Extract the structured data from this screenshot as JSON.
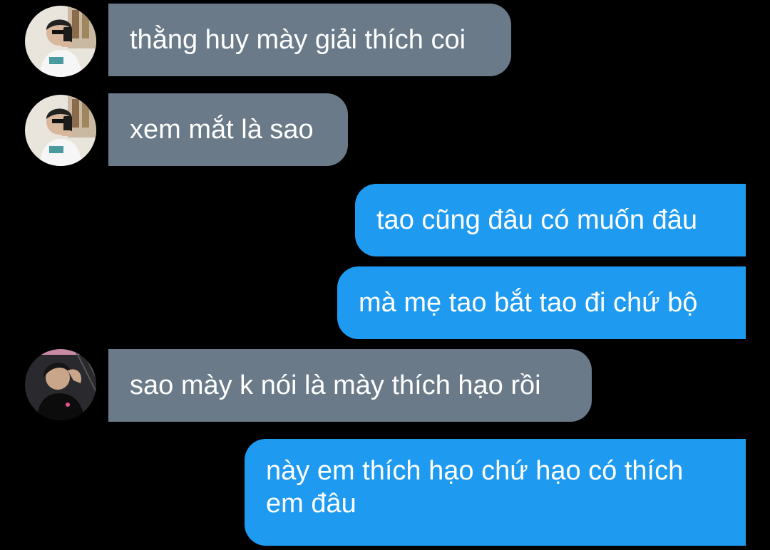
{
  "colors": {
    "background": "#000000",
    "incoming_bubble": "#6a7a89",
    "outgoing_bubble": "#1e9bf0",
    "text": "#ffffff"
  },
  "messages": [
    {
      "direction": "incoming",
      "text": "thằng huy mày giải thích coi",
      "avatar": "avatar-user-1"
    },
    {
      "direction": "incoming",
      "text": "xem mắt là sao",
      "avatar": "avatar-user-1"
    },
    {
      "direction": "outgoing",
      "text": "tao cũng đâu có muốn đâu"
    },
    {
      "direction": "outgoing",
      "text": "mà mẹ tao bắt tao đi chứ bộ"
    },
    {
      "direction": "incoming",
      "text": "sao mày k nói là mày thích hạo rồi",
      "avatar": "avatar-user-2"
    },
    {
      "direction": "outgoing",
      "text": "này em thích hạo chứ hạo có thích em đâu"
    }
  ]
}
